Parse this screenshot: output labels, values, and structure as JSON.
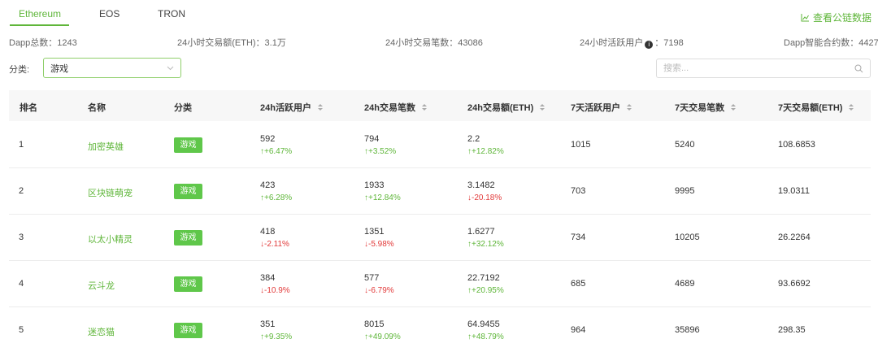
{
  "tabs": [
    {
      "label": "Ethereum",
      "active": true
    },
    {
      "label": "EOS",
      "active": false
    },
    {
      "label": "TRON",
      "active": false
    }
  ],
  "view_data_label": "查看公链数据",
  "stats": {
    "dapp_total": "Dapp总数：1243",
    "volume_24h": "24小时交易额(ETH)：3.1万",
    "tx_24h": "24小时交易笔数：43086",
    "active_24h_label": "24小时活跃用户",
    "active_24h_value": "：7198",
    "contracts": "Dapp智能合约数：4427"
  },
  "filter": {
    "label": "分类:",
    "selected": "游戏",
    "search_placeholder": "搜索..."
  },
  "columns": [
    "排名",
    "名称",
    "分类",
    "24h活跃用户",
    "24h交易笔数",
    "24h交易额(ETH)",
    "7天活跃用户",
    "7天交易笔数",
    "7天交易额(ETH)"
  ],
  "rows": [
    {
      "rank": "1",
      "name": "加密英雄",
      "category": "游戏",
      "users24": "592",
      "users24_delta": "↑+6.47%",
      "users24_dir": "up",
      "tx24": "794",
      "tx24_delta": "↑+3.52%",
      "tx24_dir": "up",
      "vol24": "2.2",
      "vol24_delta": "↑+12.82%",
      "vol24_dir": "up",
      "users7": "1015",
      "tx7": "5240",
      "vol7": "108.6853"
    },
    {
      "rank": "2",
      "name": "区块链萌宠",
      "category": "游戏",
      "users24": "423",
      "users24_delta": "↑+6.28%",
      "users24_dir": "up",
      "tx24": "1933",
      "tx24_delta": "↑+12.84%",
      "tx24_dir": "up",
      "vol24": "3.1482",
      "vol24_delta": "↓-20.18%",
      "vol24_dir": "down",
      "users7": "703",
      "tx7": "9995",
      "vol7": "19.0311"
    },
    {
      "rank": "3",
      "name": "以太小精灵",
      "category": "游戏",
      "users24": "418",
      "users24_delta": "↓-2.11%",
      "users24_dir": "down",
      "tx24": "1351",
      "tx24_delta": "↓-5.98%",
      "tx24_dir": "down",
      "vol24": "1.6277",
      "vol24_delta": "↑+32.12%",
      "vol24_dir": "up",
      "users7": "734",
      "tx7": "10205",
      "vol7": "26.2264"
    },
    {
      "rank": "4",
      "name": "云斗龙",
      "category": "游戏",
      "users24": "384",
      "users24_delta": "↓-10.9%",
      "users24_dir": "down",
      "tx24": "577",
      "tx24_delta": "↓-6.79%",
      "tx24_dir": "down",
      "vol24": "22.7192",
      "vol24_delta": "↑+20.95%",
      "vol24_dir": "up",
      "users7": "685",
      "tx7": "4689",
      "vol7": "93.6692"
    },
    {
      "rank": "5",
      "name": "迷恋猫",
      "category": "游戏",
      "users24": "351",
      "users24_delta": "↑+9.35%",
      "users24_dir": "up",
      "tx24": "8015",
      "tx24_delta": "↑+49.09%",
      "tx24_dir": "up",
      "vol24": "64.9455",
      "vol24_delta": "↑+48.79%",
      "vol24_dir": "up",
      "users7": "964",
      "tx7": "35896",
      "vol7": "298.35"
    }
  ],
  "colors": {
    "accent": "#5fb63a",
    "tag": "#5fc74a",
    "down": "#e23b3b"
  }
}
